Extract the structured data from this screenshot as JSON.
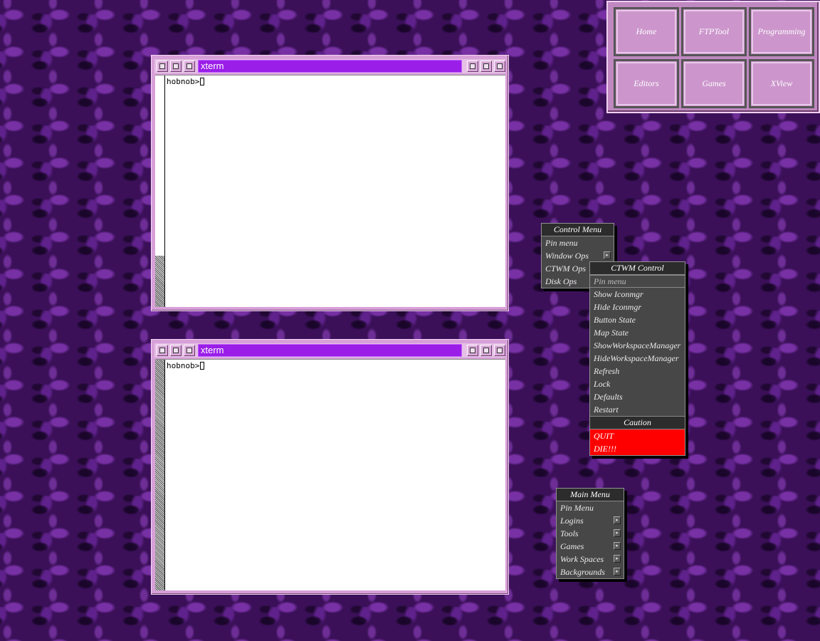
{
  "xterm_windows": [
    {
      "title": "xterm",
      "prompt": "hobnob>"
    },
    {
      "title": "xterm",
      "prompt": "hobnob>"
    }
  ],
  "button_box": {
    "buttons": [
      "Home",
      "FTPTool",
      "Programming",
      "Editors",
      "Games",
      "XView"
    ]
  },
  "control_menu": {
    "title": "Control Menu",
    "items": [
      "Pin menu",
      "Window Ops",
      "CTWM Ops",
      "Disk Ops"
    ]
  },
  "ctwm_control_menu": {
    "title": "CTWM Control",
    "items": [
      "Pin menu",
      "Show Iconmgr",
      "Hide Iconmgr",
      "Button State",
      "Map State",
      "ShowWorkspaceManager",
      "HideWorkspaceManager",
      "Refresh",
      "Lock",
      "Defaults",
      "Restart"
    ],
    "caution_label": "Caution",
    "danger_items": [
      "QUIT",
      "DIE!!!"
    ],
    "danger_color": "#ff0000"
  },
  "main_menu": {
    "title": "Main Menu",
    "items": [
      "Pin Menu",
      "Logins",
      "Tools",
      "Games",
      "Work Spaces",
      "Backgrounds"
    ]
  },
  "colors": {
    "desktop": "#3b1059",
    "title_active": "#9a1ee8",
    "menu_bg": "#474747"
  }
}
